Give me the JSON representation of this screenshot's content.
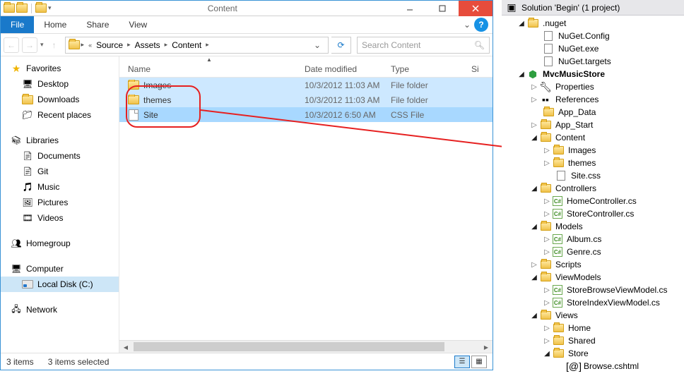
{
  "explorer": {
    "title": "Content",
    "ribbon": {
      "file": "File",
      "home": "Home",
      "share": "Share",
      "view": "View"
    },
    "breadcrumb": [
      "Source",
      "Assets",
      "Content"
    ],
    "search_placeholder": "Search Content",
    "columns": {
      "name": "Name",
      "date": "Date modified",
      "type": "Type",
      "size": "Si"
    },
    "files": [
      {
        "name": "Images",
        "date": "10/3/2012 11:03 AM",
        "type": "File folder",
        "kind": "folder"
      },
      {
        "name": "themes",
        "date": "10/3/2012 11:03 AM",
        "type": "File folder",
        "kind": "folder"
      },
      {
        "name": "Site",
        "date": "10/3/2012 6:50 AM",
        "type": "CSS File",
        "kind": "file"
      }
    ],
    "sidebar": {
      "favorites": {
        "label": "Favorites",
        "items": [
          "Desktop",
          "Downloads",
          "Recent places"
        ]
      },
      "libraries": {
        "label": "Libraries",
        "items": [
          "Documents",
          "Git",
          "Music",
          "Pictures",
          "Videos"
        ]
      },
      "homegroup": "Homegroup",
      "computer": {
        "label": "Computer",
        "drive": "Local Disk (C:)"
      },
      "network": "Network"
    },
    "status": {
      "count": "3 items",
      "selected": "3 items selected"
    }
  },
  "solution": {
    "title": "Solution 'Begin' (1 project)",
    "nuget": {
      "label": ".nuget",
      "items": [
        "NuGet.Config",
        "NuGet.exe",
        "NuGet.targets"
      ]
    },
    "project": "MvcMusicStore",
    "nodes": {
      "properties": "Properties",
      "references": "References",
      "app_data": "App_Data",
      "app_start": "App_Start",
      "content": {
        "label": "Content",
        "items": [
          "Images",
          "themes",
          "Site.css"
        ]
      },
      "controllers": {
        "label": "Controllers",
        "items": [
          "HomeController.cs",
          "StoreController.cs"
        ]
      },
      "models": {
        "label": "Models",
        "items": [
          "Album.cs",
          "Genre.cs"
        ]
      },
      "scripts": "Scripts",
      "viewmodels": {
        "label": "ViewModels",
        "items": [
          "StoreBrowseViewModel.cs",
          "StoreIndexViewModel.cs"
        ]
      },
      "views": {
        "label": "Views",
        "items": [
          "Home",
          "Shared"
        ],
        "store": {
          "label": "Store",
          "items": [
            "Browse.cshtml"
          ]
        }
      }
    }
  }
}
